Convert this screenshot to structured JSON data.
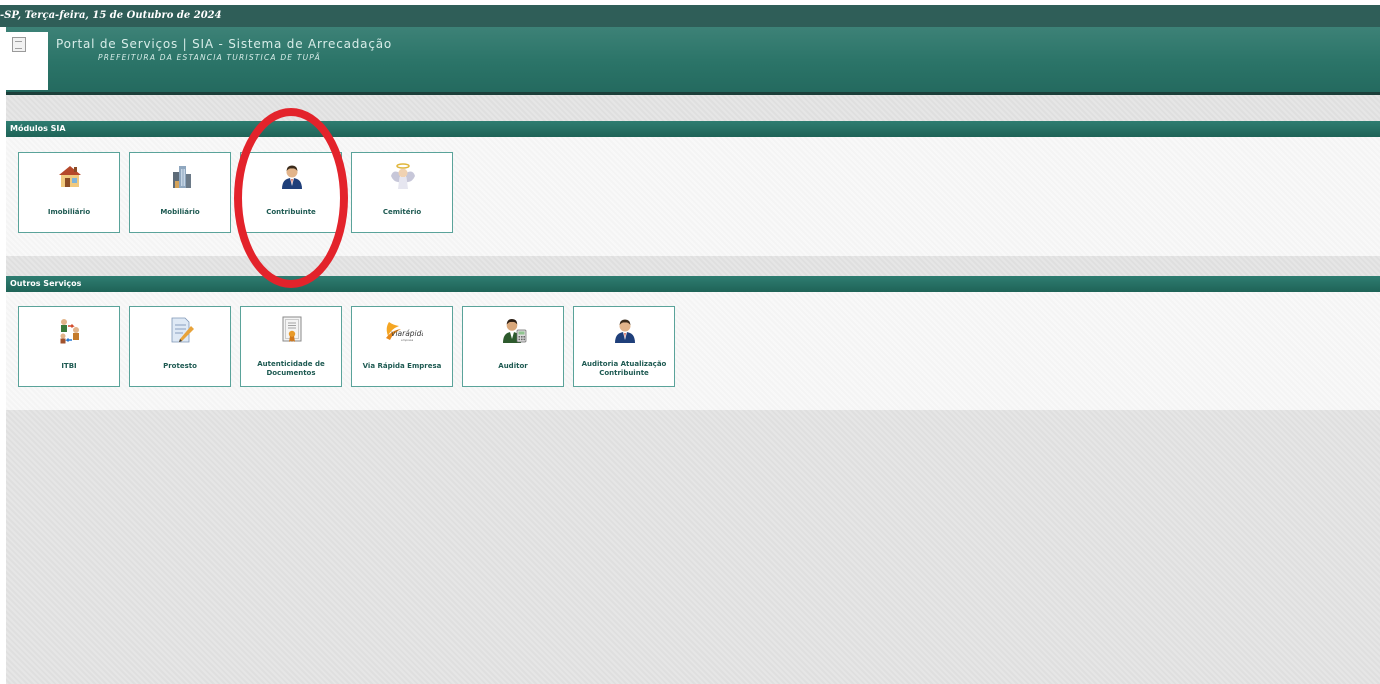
{
  "date_bar": {
    "text": "-SP, Terça-feira, 15 de Outubro de 2024"
  },
  "header": {
    "title": "Portal de Serviços | SIA - Sistema de Arrecadação",
    "subtitle": "PREFEITURA DA ESTANCIA TURISTICA DE TUPÃ"
  },
  "modulos": {
    "title": "Módulos SIA",
    "items": [
      {
        "label": "Imobiliário",
        "icon": "house-icon"
      },
      {
        "label": "Mobiliário",
        "icon": "buildings-icon"
      },
      {
        "label": "Contribuinte",
        "icon": "person-icon"
      },
      {
        "label": "Cemitério",
        "icon": "angel-icon"
      }
    ]
  },
  "outros": {
    "title": "Outros Serviços",
    "items": [
      {
        "label": "ITBI",
        "icon": "people-exchange-icon"
      },
      {
        "label": "Protesto",
        "icon": "document-pencil-icon"
      },
      {
        "label": "Autenticidade de Documentos",
        "icon": "certificate-icon"
      },
      {
        "label": "Via Rápida Empresa",
        "icon": "via-rapida-logo-icon",
        "logo_text": "viarápida",
        "logo_subtext": "empresa"
      },
      {
        "label": "Auditor",
        "icon": "auditor-icon"
      },
      {
        "label": "Auditoria Atualização Contribuinte",
        "icon": "person-icon"
      }
    ]
  },
  "colors": {
    "header_teal": "#2b7468",
    "date_bar": "#2f5e58",
    "tile_border": "#5aa39a",
    "label_text": "#1e5a52",
    "highlight": "#e3232b"
  }
}
